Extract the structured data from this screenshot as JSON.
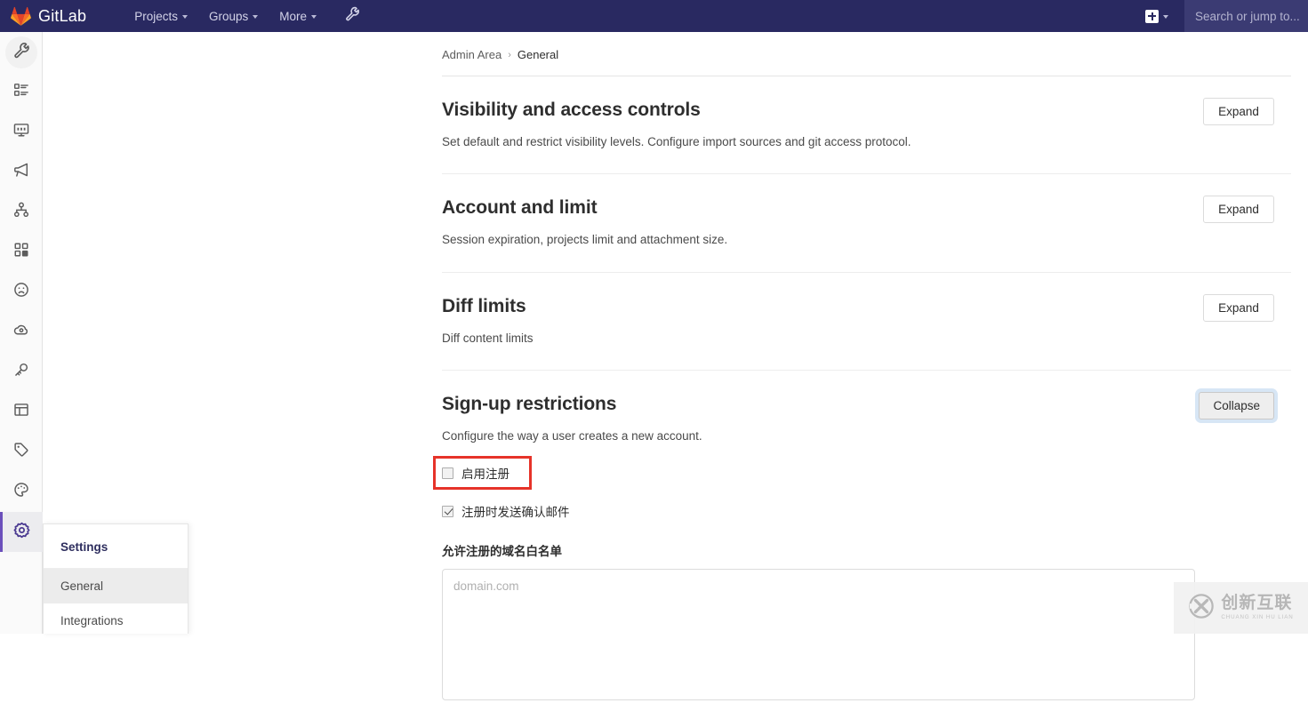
{
  "navbar": {
    "brand": "GitLab",
    "links": [
      {
        "label": "Projects",
        "icon": "chevron-down-icon"
      },
      {
        "label": "Groups",
        "icon": "chevron-down-icon"
      },
      {
        "label": "More",
        "icon": "chevron-down-icon"
      }
    ],
    "admin_icon": "wrench-icon",
    "plus_icon": "plus-square-icon",
    "plus_caret_icon": "chevron-down-icon",
    "search_placeholder": "Search or jump to...",
    "bg_color": "#292961"
  },
  "rail": {
    "items": [
      {
        "name": "overview",
        "icon": "wrench-icon",
        "active": false,
        "circle": true
      },
      {
        "name": "projects",
        "icon": "list-detail-icon",
        "active": false
      },
      {
        "name": "monitoring",
        "icon": "monitor-icon",
        "active": false
      },
      {
        "name": "messages",
        "icon": "megaphone-icon",
        "active": false
      },
      {
        "name": "system-hooks",
        "icon": "hook-icon",
        "active": false
      },
      {
        "name": "applications",
        "icon": "grid-squares-icon",
        "active": false
      },
      {
        "name": "abuse-reports",
        "icon": "frown-face-icon",
        "active": false
      },
      {
        "name": "kubernetes",
        "icon": "cloud-gear-icon",
        "active": false
      },
      {
        "name": "deploy-keys",
        "icon": "key-icon",
        "active": false
      },
      {
        "name": "service-templates",
        "icon": "template-icon",
        "active": false
      },
      {
        "name": "labels",
        "icon": "tag-icon",
        "active": false
      },
      {
        "name": "appearance",
        "icon": "palette-icon",
        "active": false
      },
      {
        "name": "settings",
        "icon": "gear-icon",
        "active": true
      }
    ],
    "active_color": "#6b4fbb"
  },
  "flyout": {
    "title": "Settings",
    "items": [
      {
        "label": "General",
        "active": true
      },
      {
        "label": "Integrations",
        "active": false
      }
    ]
  },
  "breadcrumb": {
    "root": "Admin Area",
    "separator": "›",
    "current": "General"
  },
  "sections": [
    {
      "title": "Visibility and access controls",
      "desc": "Set default and restrict visibility levels. Configure import sources and git access protocol.",
      "button": "Expand",
      "focused": false
    },
    {
      "title": "Account and limit",
      "desc": "Session expiration, projects limit and attachment size.",
      "button": "Expand",
      "focused": false
    },
    {
      "title": "Diff limits",
      "desc": "Diff content limits",
      "button": "Expand",
      "focused": false
    },
    {
      "title": "Sign-up restrictions",
      "desc": "Configure the way a user creates a new account.",
      "button": "Collapse",
      "focused": true
    }
  ],
  "signup": {
    "checkbox_enable": {
      "label": "启用注册",
      "checked": false,
      "highlighted": true,
      "highlight_color": "#e63329"
    },
    "checkbox_confirm_email": {
      "label": "注册时发送确认邮件",
      "checked": true
    },
    "domain_whitelist_label": "允许注册的域名白名单",
    "domain_whitelist_placeholder": "domain.com",
    "domain_whitelist_value": ""
  },
  "watermark": {
    "cn": "创新互联",
    "en": "CHUANG XIN HU LIAN",
    "logo": "cx-circle-logo"
  }
}
